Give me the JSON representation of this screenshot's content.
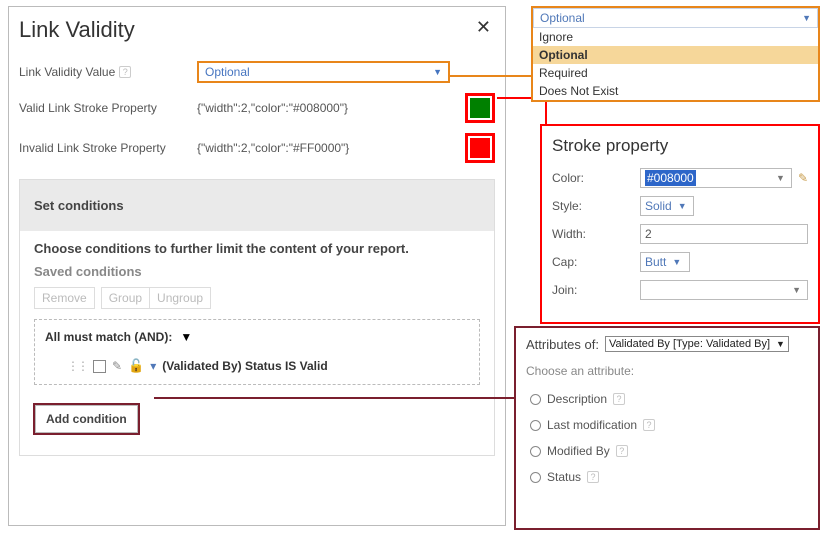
{
  "dialog": {
    "title": "Link Validity",
    "labels": {
      "value": "Link Validity Value",
      "valid_stroke": "Valid Link Stroke Property",
      "invalid_stroke": "Invalid Link Stroke Property"
    },
    "selected_value": "Optional",
    "valid_stroke_json": "{\"width\":2,\"color\":\"#008000\"}",
    "invalid_stroke_json": "{\"width\":2,\"color\":\"#FF0000\"}",
    "swatch_valid": "#008000",
    "swatch_invalid": "#FF0000"
  },
  "dropdown": {
    "selected": "Optional",
    "options": [
      "Ignore",
      "Optional",
      "Required",
      "Does Not Exist"
    ]
  },
  "conditions": {
    "header": "Set conditions",
    "description": "Choose conditions to further limit the content of your report.",
    "saved_label": "Saved conditions",
    "buttons": {
      "remove": "Remove",
      "group": "Group",
      "ungroup": "Ungroup"
    },
    "and_label": "All must match (AND):",
    "condition_text": "(Validated By) Status IS Valid",
    "add_button": "Add condition"
  },
  "stroke": {
    "title": "Stroke property",
    "labels": {
      "color": "Color:",
      "style": "Style:",
      "width": "Width:",
      "cap": "Cap:",
      "join": "Join:"
    },
    "values": {
      "color": "#008000",
      "style": "Solid",
      "width": "2",
      "cap": "Butt",
      "join": ""
    }
  },
  "attrs": {
    "head": "Attributes of:",
    "selected": "Validated By [Type: Validated By]",
    "choose": "Choose an attribute:",
    "options": [
      "Description",
      "Last modification",
      "Modified By",
      "Status"
    ]
  }
}
